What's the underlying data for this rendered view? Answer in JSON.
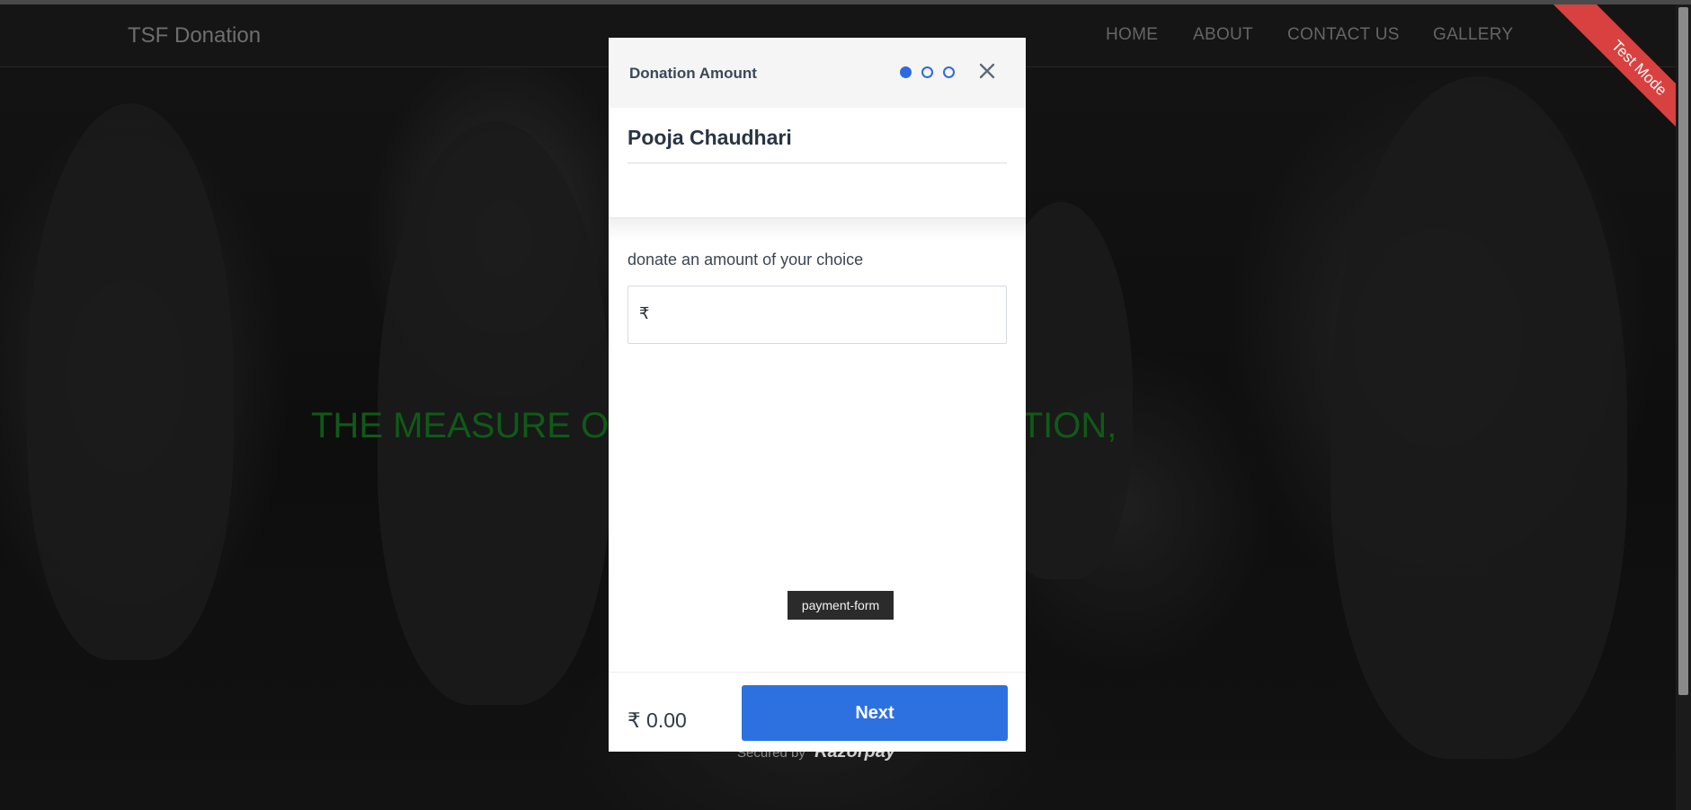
{
  "navbar": {
    "brand": "TSF Donation",
    "links": [
      "HOME",
      "ABOUT",
      "CONTACT US",
      "GALLERY"
    ]
  },
  "hero": {
    "quote": "THE MEASURE OF LIFE IS NOT ITS DURATION,"
  },
  "ribbon": {
    "label": "Test Mode",
    "color": "#d8413f"
  },
  "footer": {
    "secured_label": "Secured by",
    "brand": "Razorpay"
  },
  "modal": {
    "title": "Donation Amount",
    "steps": {
      "total": 3,
      "current": 1
    },
    "close_icon": "close-icon",
    "payee_name": "Pooja Chaudhari",
    "amount_label": "donate an amount of your choice",
    "currency_symbol": "₹",
    "amount_value": "",
    "tooltip": "payment-form",
    "total_display": "₹ 0.00",
    "next_label": "Next",
    "accent_color": "#2d70e0"
  }
}
